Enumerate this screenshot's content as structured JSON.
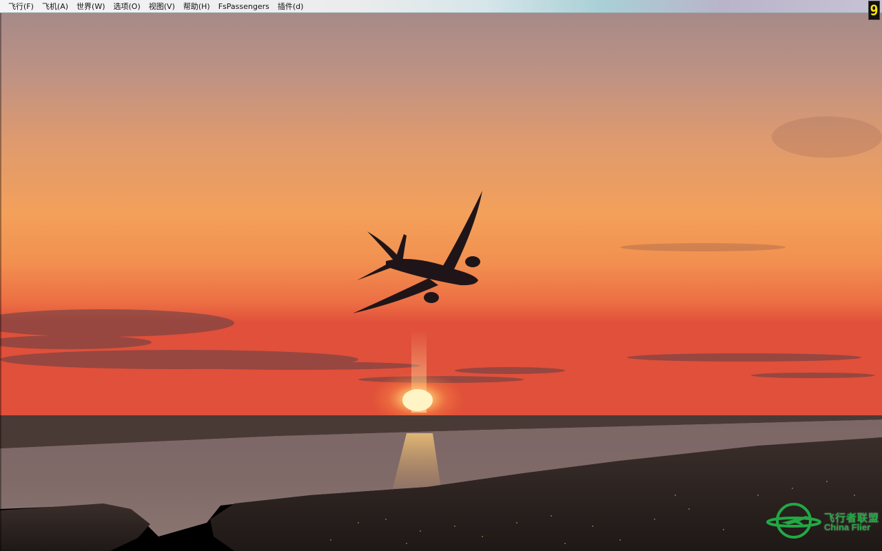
{
  "menubar": {
    "items": [
      {
        "label": "飞行(F)"
      },
      {
        "label": "飞机(A)"
      },
      {
        "label": "世界(W)"
      },
      {
        "label": "选项(O)"
      },
      {
        "label": "视图(V)"
      },
      {
        "label": "帮助(H)"
      },
      {
        "label": "FsPassengers"
      },
      {
        "label": "插件(d)"
      }
    ]
  },
  "frame_counter": "9",
  "scene": {
    "sky_colors": {
      "top": "#a98a86",
      "mid": "#f09a55",
      "horizon": "#e2503a"
    },
    "water_color": "#6e5c5a",
    "land_color": "#2a2320",
    "sun_color": "#fff2b8",
    "aircraft_color": "#1e1418"
  },
  "watermark": {
    "text_cn": "飞行者联盟",
    "text_en": "China Flier",
    "color": "#22a845",
    "icon": "airplane-globe-logo"
  }
}
